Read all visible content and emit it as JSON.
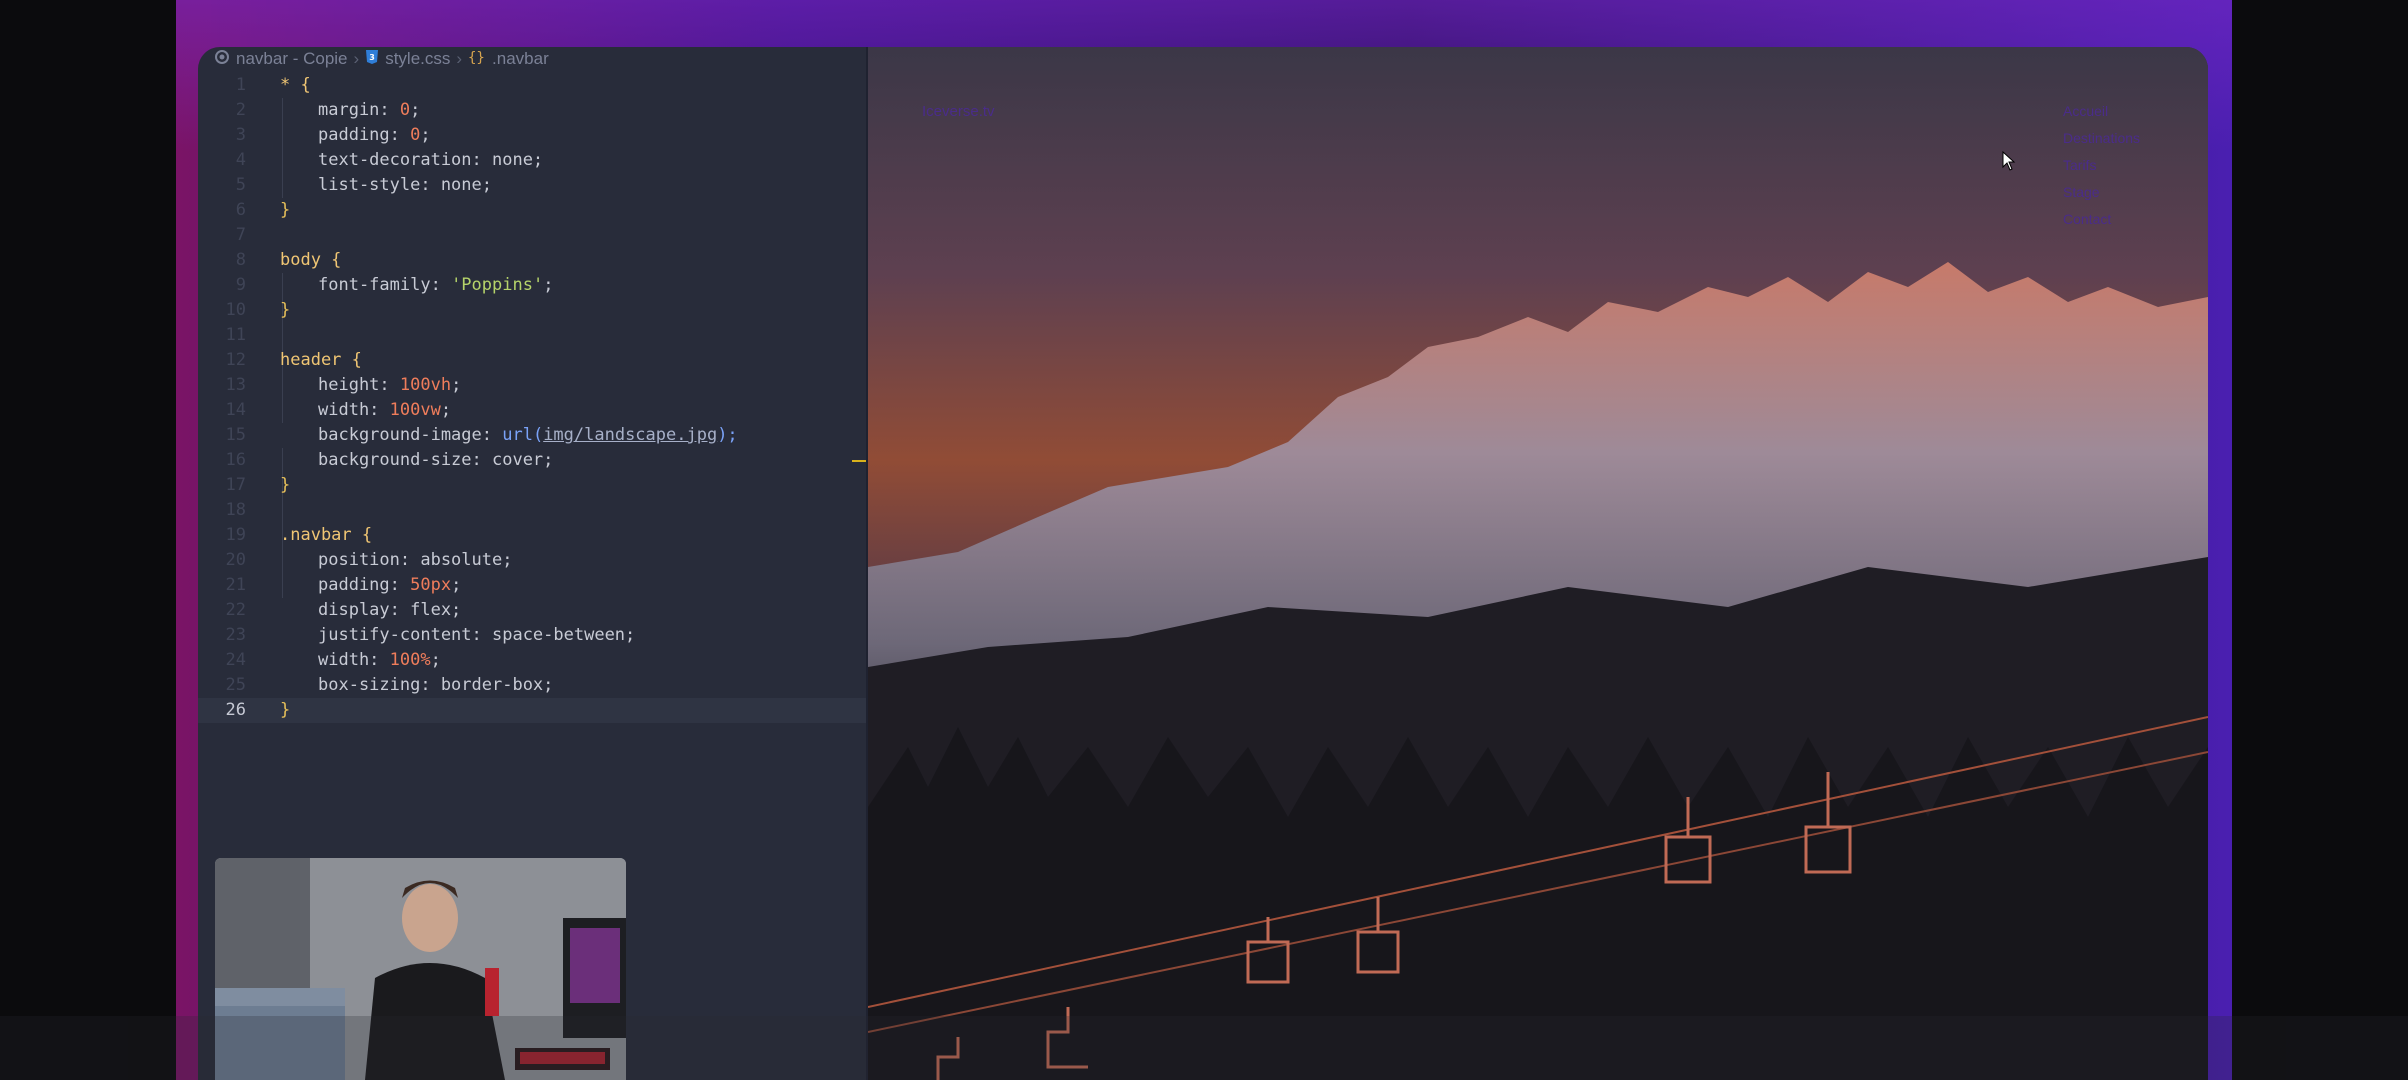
{
  "breadcrumb": {
    "folder": "navbar - Copie",
    "file": "style.css",
    "symbol": ".navbar",
    "folder_icon": "folder-circle-icon",
    "file_icon": "css-file-icon",
    "symbol_icon": "brace-symbol-icon"
  },
  "editor": {
    "active_line": 26,
    "lines": [
      {
        "n": "1"
      },
      {
        "n": "2"
      },
      {
        "n": "3"
      },
      {
        "n": "4"
      },
      {
        "n": "5"
      },
      {
        "n": "6"
      },
      {
        "n": "7"
      },
      {
        "n": "8"
      },
      {
        "n": "9"
      },
      {
        "n": "10"
      },
      {
        "n": "11"
      },
      {
        "n": "12"
      },
      {
        "n": "13"
      },
      {
        "n": "14"
      },
      {
        "n": "15"
      },
      {
        "n": "16"
      },
      {
        "n": "17"
      },
      {
        "n": "18"
      },
      {
        "n": "19"
      },
      {
        "n": "20"
      },
      {
        "n": "21"
      },
      {
        "n": "22"
      },
      {
        "n": "23"
      },
      {
        "n": "24"
      },
      {
        "n": "25"
      },
      {
        "n": "26"
      }
    ],
    "code": {
      "l1_sel": "* {",
      "l2_prop": "margin: ",
      "l2_val": "0",
      "l2_end": ";",
      "l3_prop": "padding: ",
      "l3_val": "0",
      "l3_end": ";",
      "l4": "text-decoration: none;",
      "l5": "list-style: none;",
      "l6": "}",
      "l8_sel": "body {",
      "l9_prop": "font-family: ",
      "l9_val": "'Poppins'",
      "l9_end": ";",
      "l10": "}",
      "l12_sel": "header {",
      "l13_prop": "height: ",
      "l13_val": "100vh",
      "l13_end": ";",
      "l14_prop": "width: ",
      "l14_val": "100vw",
      "l14_end": ";",
      "l15_prop": "background-image: ",
      "l15_fn": "url(",
      "l15_url": "img/landscape.jpg",
      "l15_end": ");",
      "l16": "background-size: cover;",
      "l17": "}",
      "l19_sel": ".navbar {",
      "l20": "position: absolute;",
      "l21_prop": "padding: ",
      "l21_val": "50px",
      "l21_end": ";",
      "l22": "display: flex;",
      "l23": "justify-content: space-between;",
      "l24_prop": "width: ",
      "l24_val": "100%",
      "l24_end": ";",
      "l25": "box-sizing: border-box;",
      "l26": "}"
    }
  },
  "preview": {
    "logo": "Iceverse.tv",
    "nav": [
      "Accueil",
      "Destinations",
      "Tarifs",
      "Stage",
      "Contact"
    ],
    "background_note": "landscape"
  },
  "colors": {
    "editor_bg": "#282c3a",
    "selector": "#f0c674",
    "number": "#ef7d5b",
    "string": "#b5d36a",
    "accent_frame": "#4a1fb0"
  }
}
